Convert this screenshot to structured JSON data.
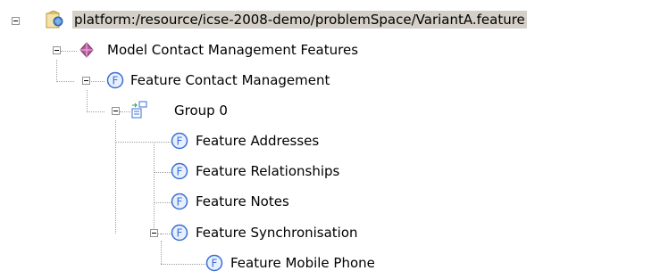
{
  "tree": {
    "root": {
      "label": "platform:/resource/icse-2008-demo/problemSpace/VariantA.feature",
      "icon": "feature-model-file-icon"
    },
    "model": {
      "label": "Model Contact Management Features",
      "icon": "model-diamond-icon"
    },
    "contact_management": {
      "label": "Feature Contact Management",
      "icon": "feature-f-icon"
    },
    "group": {
      "label": "Group 0",
      "icon": "group-icon"
    },
    "addresses": {
      "label": "Feature Addresses",
      "icon": "feature-f-icon"
    },
    "relationships": {
      "label": "Feature Relationships",
      "icon": "feature-f-icon"
    },
    "notes": {
      "label": "Feature Notes",
      "icon": "feature-f-icon"
    },
    "synchronisation": {
      "label": "Feature Synchronisation",
      "icon": "feature-f-icon"
    },
    "mobile_phone": {
      "label": "Feature Mobile Phone",
      "icon": "feature-f-icon"
    }
  },
  "colors": {
    "selection": "#d4d0c8",
    "feature_icon": "#3a6fd4",
    "model_icon": "#9e4a8b"
  }
}
